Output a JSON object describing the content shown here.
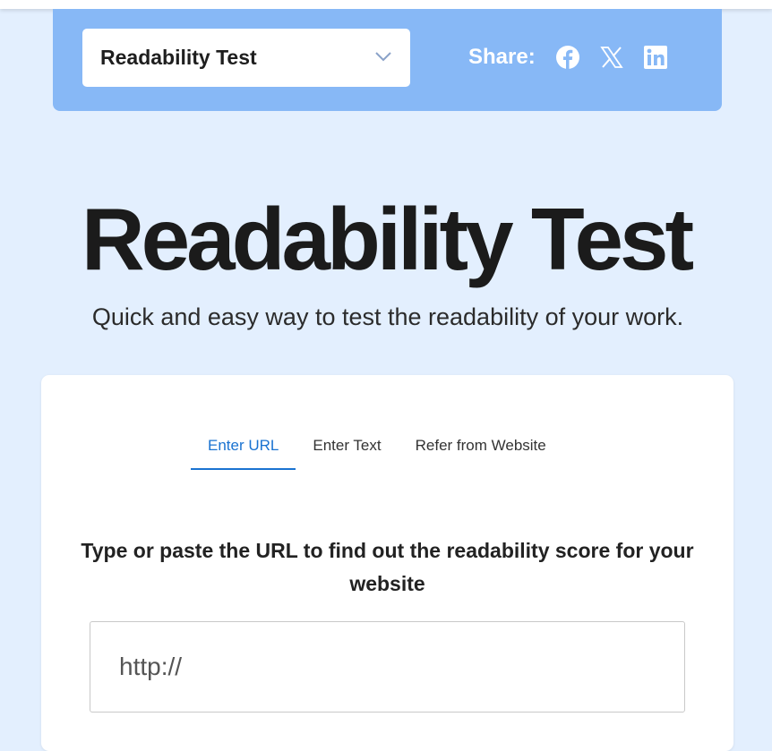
{
  "header": {
    "tool_select": {
      "label": "Readability Test"
    },
    "share": {
      "label": "Share:",
      "icons": [
        "facebook-icon",
        "x-icon",
        "linkedin-icon"
      ]
    }
  },
  "hero": {
    "title": "Readability Test",
    "subtitle": "Quick and easy way to test the readability of your work."
  },
  "card": {
    "tabs": [
      {
        "label": "Enter URL",
        "active": true
      },
      {
        "label": "Enter Text",
        "active": false
      },
      {
        "label": "Refer from Website",
        "active": false
      }
    ],
    "prompt": "Type or paste the URL to find out the readability score for your website",
    "url_input": {
      "placeholder": "http://",
      "value": ""
    }
  },
  "colors": {
    "page_bg": "#e3effe",
    "header_bg": "#87b8f6",
    "accent": "#1a73d1",
    "title_text": "#1b1b1b"
  }
}
